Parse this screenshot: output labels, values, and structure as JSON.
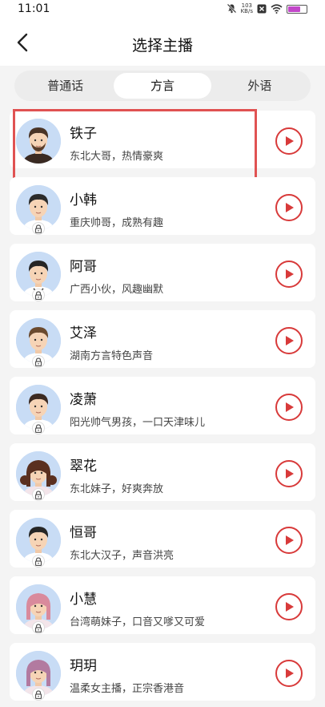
{
  "status_bar": {
    "time": "11:01",
    "net_speed_value": "103",
    "net_speed_unit": "KB/s"
  },
  "header": {
    "title": "选择主播"
  },
  "tabs": [
    {
      "label": "普通话",
      "active": false
    },
    {
      "label": "方言",
      "active": true
    },
    {
      "label": "外语",
      "active": false
    }
  ],
  "anchors": [
    {
      "name": "铁子",
      "desc": "东北大哥，热情豪爽",
      "selected": true,
      "locked": false,
      "avatar_icon": "male-avatar-beard",
      "hair_color": "#4a3426"
    },
    {
      "name": "小韩",
      "desc": "重庆帅哥，成熟有趣",
      "selected": false,
      "locked": true,
      "avatar_icon": "male-avatar",
      "hair_color": "#2b2b2b"
    },
    {
      "name": "阿哥",
      "desc": "广西小伙，风趣幽默",
      "selected": false,
      "locked": true,
      "avatar_icon": "male-avatar-suit",
      "hair_color": "#252525"
    },
    {
      "name": "艾泽",
      "desc": "湖南方言特色声音",
      "selected": false,
      "locked": true,
      "avatar_icon": "male-avatar",
      "hair_color": "#6b4a2e"
    },
    {
      "name": "凌萧",
      "desc": "阳光帅气男孩，一口天津味儿",
      "selected": false,
      "locked": true,
      "avatar_icon": "male-avatar",
      "hair_color": "#3b2a22"
    },
    {
      "name": "翠花",
      "desc": "东北妹子，好爽奔放",
      "selected": false,
      "locked": true,
      "avatar_icon": "female-avatar-pigtails",
      "hair_color": "#5a3020"
    },
    {
      "name": "恒哥",
      "desc": "东北大汉子，声音洪亮",
      "selected": false,
      "locked": true,
      "avatar_icon": "male-avatar",
      "hair_color": "#262626"
    },
    {
      "name": "小慧",
      "desc": "台湾萌妹子，口音又嗲又可爱",
      "selected": false,
      "locked": true,
      "avatar_icon": "female-avatar-bangs",
      "hair_color": "#d98a9c"
    },
    {
      "name": "玥玥",
      "desc": "温柔女主播，正宗香港音",
      "selected": false,
      "locked": true,
      "avatar_icon": "female-avatar-long",
      "hair_color": "#b27aa0"
    }
  ],
  "colors": {
    "accent": "#d83a3a",
    "selection_outline": "#e05252",
    "avatar_bg": "#c8dcf5",
    "battery": "#c247c9"
  }
}
